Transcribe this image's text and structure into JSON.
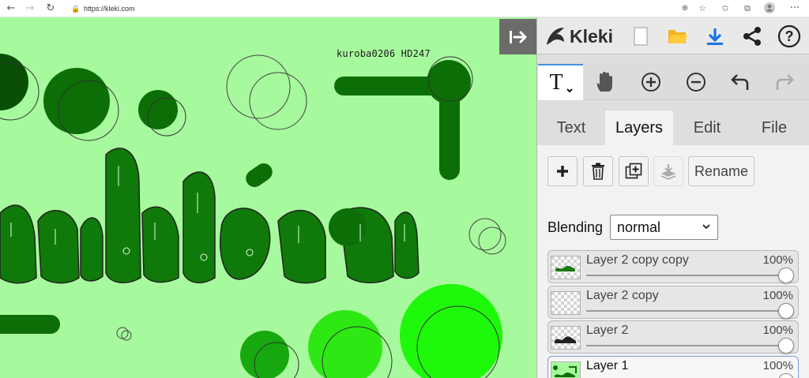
{
  "browser": {
    "url": "https://kleki.com",
    "icons": [
      "back-icon",
      "forward-icon",
      "reload-icon",
      "lock-icon",
      "zoom-icon",
      "favorite-add-icon",
      "favorites-icon",
      "collections-icon",
      "profile-icon",
      "more-icon"
    ]
  },
  "canvas": {
    "signature": "kuroba0206   HD247",
    "background": "#a7f99d",
    "colors": {
      "dark_green": "#0c6e07",
      "mid_green": "#0f7a09",
      "bright_green": "#2ee814",
      "neon_green": "#1ef80a",
      "darkest": "#0a4f06"
    }
  },
  "app": {
    "logo_text": "Kleki",
    "accent": "#1a73e8"
  },
  "tabs": [
    {
      "label": "Text"
    },
    {
      "label": "Layers"
    },
    {
      "label": "Edit"
    },
    {
      "label": "File"
    }
  ],
  "layer_actions": {
    "rename_label": "Rename"
  },
  "blending": {
    "label": "Blending",
    "value": "normal"
  },
  "layers": [
    {
      "name": "Layer 2 copy copy",
      "opacity": "100%"
    },
    {
      "name": "Layer 2 copy",
      "opacity": "100%"
    },
    {
      "name": "Layer 2",
      "opacity": "100%"
    },
    {
      "name": "Layer 1",
      "opacity": "100%"
    }
  ]
}
